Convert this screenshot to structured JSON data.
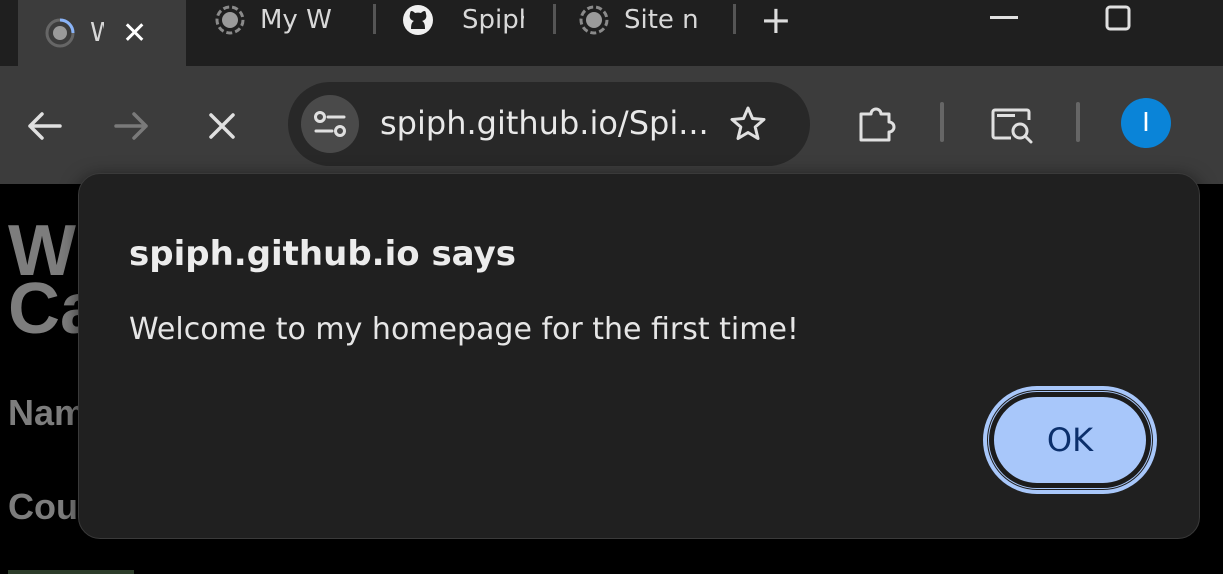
{
  "browser": {
    "tabs": [
      {
        "title": "W",
        "icon": "globe-loading-icon",
        "active": true
      },
      {
        "title": "My W",
        "icon": "globe-icon",
        "active": false
      },
      {
        "title": "Spiph",
        "icon": "github-icon",
        "active": false
      },
      {
        "title": "Site n",
        "icon": "globe-icon",
        "active": false
      }
    ],
    "new_tab_label": "+",
    "address": "spiph.github.io/Spi...",
    "avatar_letter": "I",
    "colors": {
      "accent": "#0a84d8",
      "toolbar": "#3c3c3c",
      "tabstrip": "#1f1f1f"
    }
  },
  "page": {
    "heading": "W\nCa",
    "labels": [
      "Nam",
      "Cou"
    ]
  },
  "dialog": {
    "title": "spiph.github.io says",
    "message": "Welcome to my homepage for the first time!",
    "ok_label": "OK",
    "colors": {
      "button": "#a8c7fa",
      "button_text": "#0b2f6b",
      "background": "#202020"
    }
  }
}
